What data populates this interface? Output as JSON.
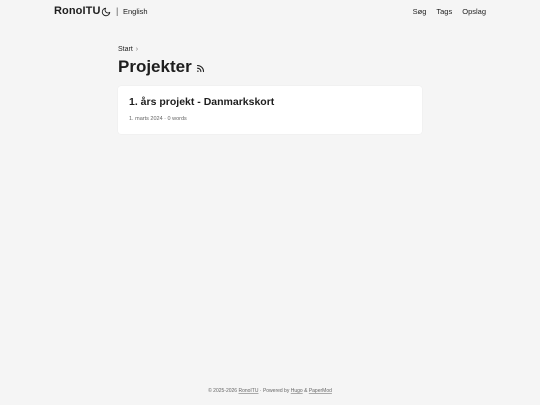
{
  "header": {
    "logo": "RonoITU",
    "theme_toggle_icon": "moon-icon",
    "separator": "|",
    "language": "English",
    "menu": [
      {
        "label": "Søg"
      },
      {
        "label": "Tags"
      },
      {
        "label": "Opslag"
      }
    ]
  },
  "main": {
    "breadcrumb": {
      "home": "Start",
      "separator": "›"
    },
    "title": "Projekter",
    "rss_icon": "rss-icon",
    "posts": [
      {
        "title": "1. års projekt - Danmarkskort",
        "date": "1. marts 2024",
        "meta_separator": "·",
        "words": "0 words"
      }
    ]
  },
  "footer": {
    "copyright": "© 2025-2026",
    "site_link": "RonoITU",
    "sep": "·",
    "powered_by": "Powered by",
    "hugo": "Hugo",
    "amp": "&",
    "papermod": "PaperMod"
  },
  "colors": {
    "background": "#f5f5f5",
    "card": "#ffffff",
    "text": "#1e1e1e",
    "muted": "#666666"
  }
}
